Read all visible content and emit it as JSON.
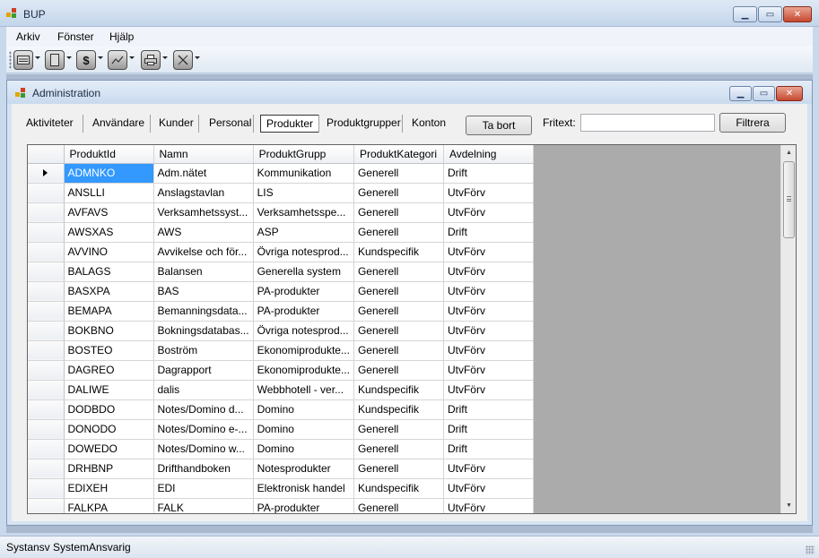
{
  "window": {
    "title": "BUP"
  },
  "menu": {
    "items": [
      "Arkiv",
      "Fönster",
      "Hjälp"
    ]
  },
  "toolbar": {
    "buttons": [
      {
        "icon": "list-window-icon"
      },
      {
        "icon": "document-icon"
      },
      {
        "icon": "dollar-icon",
        "glyph": "$"
      },
      {
        "icon": "chart-icon"
      },
      {
        "icon": "printer-icon"
      },
      {
        "icon": "tools-icon"
      }
    ]
  },
  "child": {
    "title": "Administration"
  },
  "nav": {
    "links": [
      "Aktiviteter",
      "Användare",
      "Kunder",
      "Personal",
      "Produkter",
      "Produktgrupper",
      "Konton"
    ],
    "active": "Produkter",
    "delete_label": "Ta bort",
    "filter_label": "Fritext:",
    "filter_value": "",
    "filter_button": "Filtrera"
  },
  "grid": {
    "columns": [
      "ProduktId",
      "Namn",
      "ProduktGrupp",
      "ProduktKategori",
      "Avdelning"
    ],
    "rows": [
      [
        "ADMNKO",
        "Adm.nätet",
        "Kommunikation",
        "Generell",
        "Drift"
      ],
      [
        "ANSLLI",
        "Anslagstavlan",
        "LIS",
        "Generell",
        "UtvFörv"
      ],
      [
        "AVFAVS",
        "Verksamhetssyst...",
        "Verksamhetsspe...",
        "Generell",
        "UtvFörv"
      ],
      [
        "AWSXAS",
        "AWS",
        "ASP",
        "Generell",
        "Drift"
      ],
      [
        "AVVINO",
        "Avvikelse och för...",
        "Övriga notesprod...",
        "Kundspecifik",
        "UtvFörv"
      ],
      [
        "BALAGS",
        "Balansen",
        "Generella system",
        "Generell",
        "UtvFörv"
      ],
      [
        "BASXPA",
        "BAS",
        "PA-produkter",
        "Generell",
        "UtvFörv"
      ],
      [
        "BEMAPA",
        "Bemanningsdata...",
        "PA-produkter",
        "Generell",
        "UtvFörv"
      ],
      [
        "BOKBNO",
        "Bokningsdatabas...",
        "Övriga notesprod...",
        "Generell",
        "UtvFörv"
      ],
      [
        "BOSTEO",
        "Boström",
        "Ekonomiprodukte...",
        "Generell",
        "UtvFörv"
      ],
      [
        "DAGREO",
        "Dagrapport",
        "Ekonomiprodukte...",
        "Generell",
        "UtvFörv"
      ],
      [
        "DALIWE",
        "dalis",
        "Webbhotell - ver...",
        "Kundspecifik",
        "UtvFörv"
      ],
      [
        "DODBDO",
        "Notes/Domino d...",
        "Domino",
        "Kundspecifik",
        "Drift"
      ],
      [
        "DONODO",
        "Notes/Domino e-...",
        "Domino",
        "Generell",
        "Drift"
      ],
      [
        "DOWEDO",
        "Notes/Domino w...",
        "Domino",
        "Generell",
        "Drift"
      ],
      [
        "DRHBNP",
        "Drifthandboken",
        "Notesprodukter",
        "Generell",
        "UtvFörv"
      ],
      [
        "EDIXEH",
        "EDI",
        "Elektronisk handel",
        "Kundspecifik",
        "UtvFörv"
      ],
      [
        "FALKPA",
        "FALK",
        "PA-produkter",
        "Generell",
        "UtvFörv"
      ]
    ],
    "selected_row": 0
  },
  "status": {
    "text": "Systansv SystemAnsvarig"
  }
}
